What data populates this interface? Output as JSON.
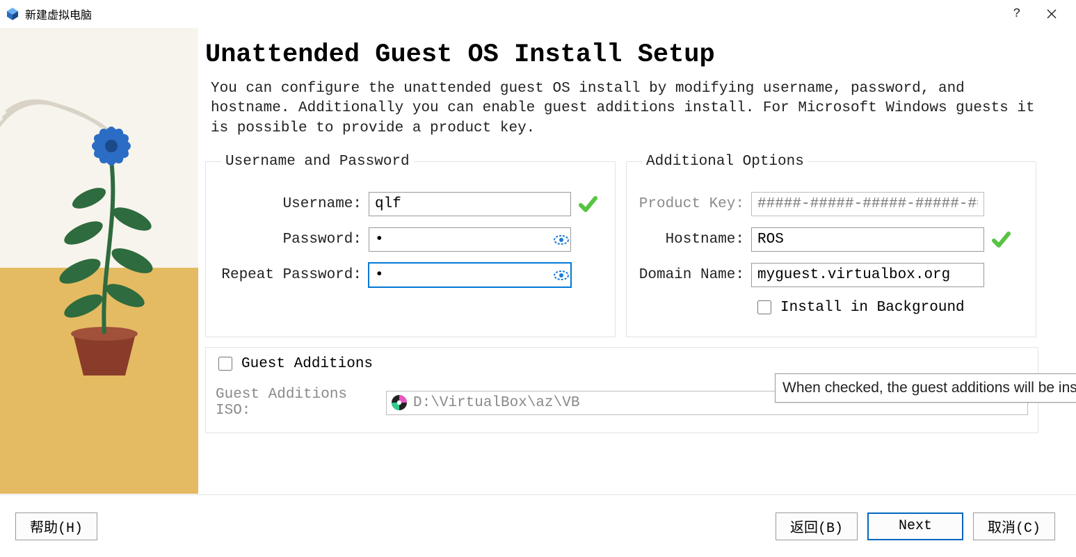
{
  "window": {
    "title": "新建虚拟电脑"
  },
  "page": {
    "heading": "Unattended Guest OS Install Setup",
    "description": "You can configure the unattended guest OS install by modifying username, password, and hostname. Additionally you can enable guest additions install. For Microsoft Windows guests it is possible to provide a product key."
  },
  "group_left": {
    "legend": "Username and Password",
    "username_label": "Username:",
    "username_value": "qlf",
    "password_label": "Password:",
    "password_value": "•",
    "repeat_label": "Repeat Password:",
    "repeat_value": "•"
  },
  "group_right": {
    "legend": "Additional Options",
    "product_key_label": "Product Key:",
    "product_key_placeholder": "#####-#####-#####-#####-#####",
    "hostname_label": "Hostname:",
    "hostname_value": "ROS",
    "domain_label": "Domain Name:",
    "domain_value": "myguest.virtualbox.org",
    "install_bg_label": "Install in Background"
  },
  "guest_add": {
    "checkbox_label": "Guest Additions",
    "iso_label": "Guest Additions ISO:",
    "iso_path": "D:\\VirtualBox\\az\\VB"
  },
  "tooltip": {
    "text": "When checked, the guest additions will be installed after the"
  },
  "footer": {
    "help": "帮助(H)",
    "back": "返回(B)",
    "next": "Next",
    "cancel": "取消(C)"
  }
}
